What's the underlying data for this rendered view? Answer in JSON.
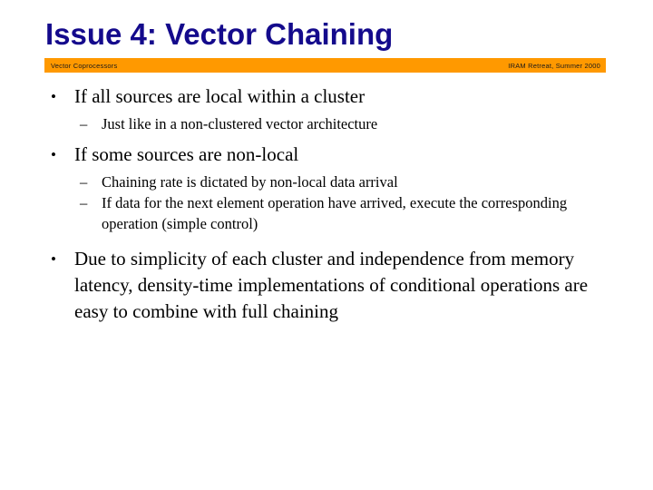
{
  "slide": {
    "title": "Issue 4: Vector Chaining",
    "title_color": "#140a8c",
    "background_color": "#ffffff",
    "body_color": "#000000"
  },
  "header_bar": {
    "background_color": "#ff9900",
    "left_text": "Vector Coprocessors",
    "right_text": "IRAM Retreat, Summer 2000"
  },
  "markers": {
    "level1": "•",
    "level2": "–"
  },
  "content": {
    "blocks": [
      {
        "level": 1,
        "text": "If all sources are local within a cluster"
      },
      {
        "level": 2,
        "text": "Just like in a non-clustered vector architecture"
      },
      {
        "level": 1,
        "text": "If some sources are non-local"
      },
      {
        "level": 2,
        "text": "Chaining rate is dictated by non-local data arrival"
      },
      {
        "level": 2,
        "text": "If data for the next element operation have arrived, execute the corresponding operation (simple control)"
      },
      {
        "level": 1,
        "text": "Due to simplicity of each cluster and independence from memory latency, density-time implementations of conditional operations are easy to combine with full chaining"
      }
    ]
  }
}
